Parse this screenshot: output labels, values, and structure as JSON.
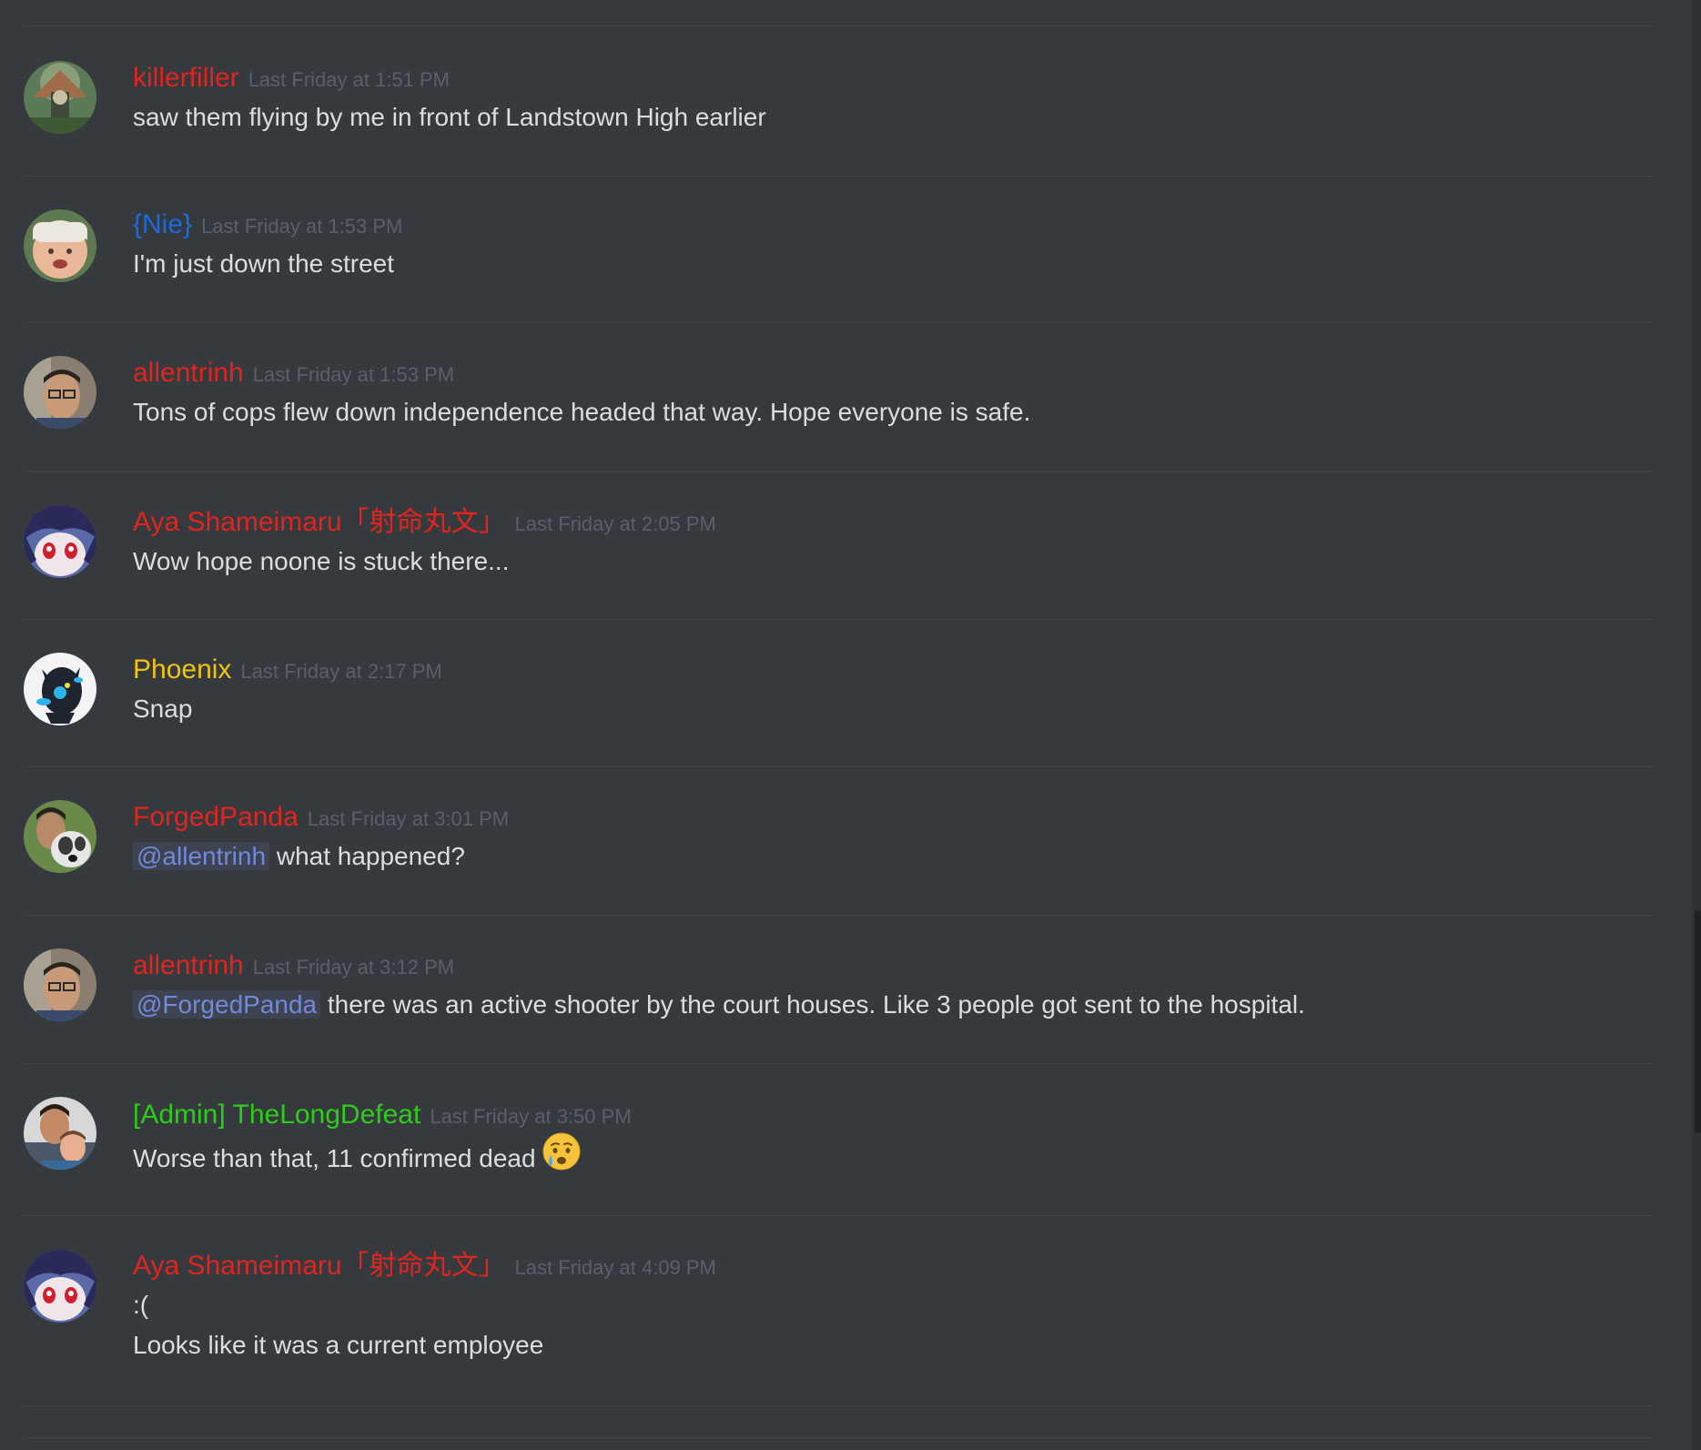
{
  "colors": {
    "background": "#36393e",
    "divider": "#40434a",
    "text": "#dcddde",
    "timestamp": "#5c5f66",
    "mention": "#7289da",
    "red_role": "#e0251f",
    "blue_role": "#1b6bde",
    "yellow_role": "#f1c40f",
    "green_role": "#2ecc1a"
  },
  "messages": [
    {
      "username": "killerfiller",
      "timestamp": "Last Friday at 1:51 PM",
      "lines": [
        "saw them flying by me in front of Landstown High earlier"
      ]
    },
    {
      "username": "{Nie}",
      "timestamp": "Last Friday at 1:53 PM",
      "lines": [
        "I'm just down the street"
      ]
    },
    {
      "username": "allentrinh",
      "timestamp": "Last Friday at 1:53 PM",
      "lines": [
        "Tons of cops flew down independence headed that way. Hope everyone is safe."
      ]
    },
    {
      "username": "Aya Shameimaru「射命丸文」",
      "timestamp": "Last Friday at 2:05 PM",
      "lines": [
        "Wow hope noone is stuck there..."
      ]
    },
    {
      "username": "Phoenix",
      "timestamp": "Last Friday at 2:17 PM",
      "lines": [
        "Snap"
      ]
    },
    {
      "username": "ForgedPanda",
      "timestamp": "Last Friday at 3:01 PM",
      "mention": "@allentrinh",
      "lines": [
        "what happened?"
      ]
    },
    {
      "username": "allentrinh",
      "timestamp": "Last Friday at 3:12 PM",
      "mention": "@ForgedPanda",
      "lines": [
        "there was an active shooter by the court houses. Like 3 people got sent to the hospital."
      ]
    },
    {
      "username": "[Admin] TheLongDefeat",
      "timestamp": "Last Friday at 3:50 PM",
      "lines": [
        "Worse than that, 11 confirmed dead"
      ],
      "emoji": "crying-face-emoji"
    },
    {
      "username": "Aya Shameimaru「射命丸文」",
      "timestamp": "Last Friday at 4:09 PM",
      "lines": [
        ":(",
        "Looks like it was a current employee"
      ]
    }
  ]
}
